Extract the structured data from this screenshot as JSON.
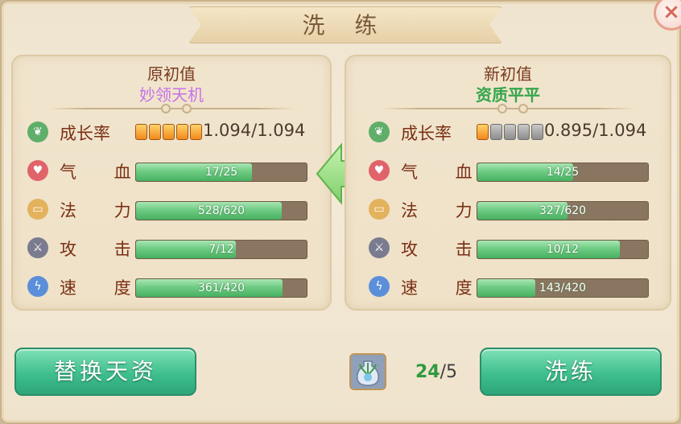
{
  "dialog": {
    "title": "洗 练",
    "close_label": "×"
  },
  "left_panel": {
    "title": "原初值",
    "subtitle": "妙领天机",
    "growth": {
      "label": "成长率",
      "stars_filled": 5,
      "stars_total": 5,
      "value_text": "1.094/1.094"
    },
    "stats": [
      {
        "label": "气 血",
        "icon": "heart-icon",
        "current": 17,
        "max": 25,
        "text": "17/25"
      },
      {
        "label": "法 力",
        "icon": "scroll-icon",
        "current": 528,
        "max": 620,
        "text": "528/620"
      },
      {
        "label": "攻 击",
        "icon": "sword-icon",
        "current": 7,
        "max": 12,
        "text": "7/12"
      },
      {
        "label": "速 度",
        "icon": "lightning-icon",
        "current": 361,
        "max": 420,
        "text": "361/420"
      }
    ]
  },
  "right_panel": {
    "title": "新初值",
    "subtitle": "资质平平",
    "growth": {
      "label": "成长率",
      "stars_filled": 1,
      "stars_total": 5,
      "value_text": "0.895/1.094"
    },
    "stats": [
      {
        "label": "气 血",
        "icon": "heart-icon",
        "current": 14,
        "max": 25,
        "text": "14/25"
      },
      {
        "label": "法 力",
        "icon": "scroll-icon",
        "current": 327,
        "max": 620,
        "text": "327/620"
      },
      {
        "label": "攻 击",
        "icon": "sword-icon",
        "current": 10,
        "max": 12,
        "text": "10/12"
      },
      {
        "label": "速 度",
        "icon": "lightning-icon",
        "current": 143,
        "max": 420,
        "text": "143/420"
      }
    ]
  },
  "actions": {
    "replace_label": "替换天资",
    "wash_label": "洗练"
  },
  "item": {
    "icon": "potion-vase-icon",
    "have": "24",
    "separator": "/",
    "need": "5"
  },
  "colors": {
    "accent_green": "#3fbf8d",
    "bar_fill": "#6fcb83",
    "title_brown": "#7a2f14",
    "left_subtitle": "#c572e8",
    "right_subtitle": "#33a64a"
  }
}
